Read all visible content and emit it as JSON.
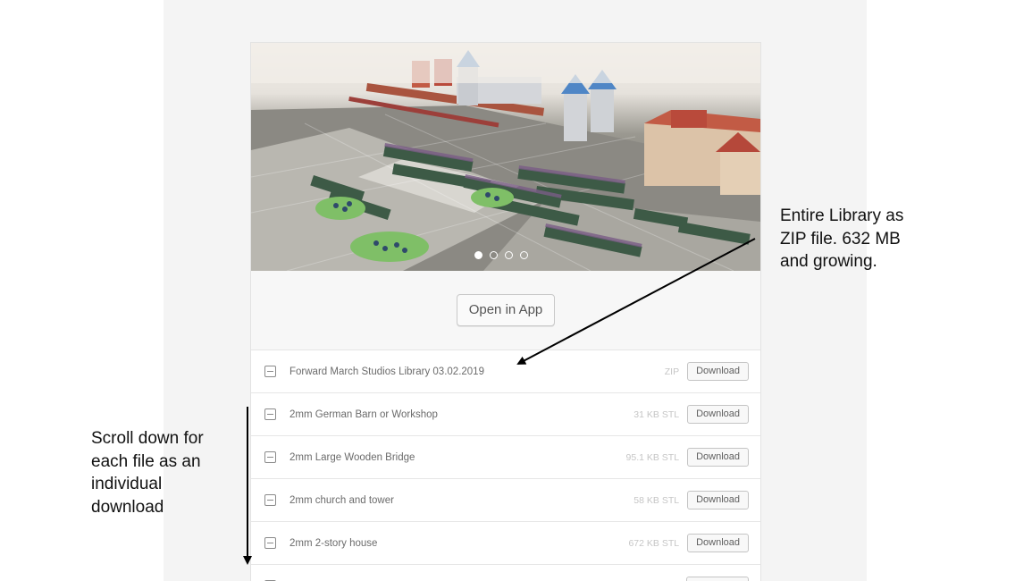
{
  "carousel": {
    "slide_count": 4,
    "active_slide": 1
  },
  "open_button": "Open in App",
  "files": [
    {
      "name": "Forward March Studios Library 03.02.2019",
      "meta": "ZIP",
      "action": "Download"
    },
    {
      "name": "2mm German Barn or Workshop",
      "meta": "31 KB STL",
      "action": "Download"
    },
    {
      "name": "2mm Large Wooden Bridge",
      "meta": "95.1 KB STL",
      "action": "Download"
    },
    {
      "name": "2mm church and tower",
      "meta": "58 KB STL",
      "action": "Download"
    },
    {
      "name": "2mm 2-story house",
      "meta": "672 KB STL",
      "action": "Download"
    },
    {
      "name": "",
      "meta": "",
      "action": ""
    }
  ],
  "annotations": {
    "library": [
      "Entire Library as",
      "ZIP file.  632 MB",
      "and growing."
    ],
    "scroll": [
      "Scroll down for",
      "each file as an",
      "individual",
      "download"
    ]
  },
  "colors": {
    "page_background": "#f4f4f4",
    "card_background": "#ffffff",
    "arrow": "#000000"
  }
}
